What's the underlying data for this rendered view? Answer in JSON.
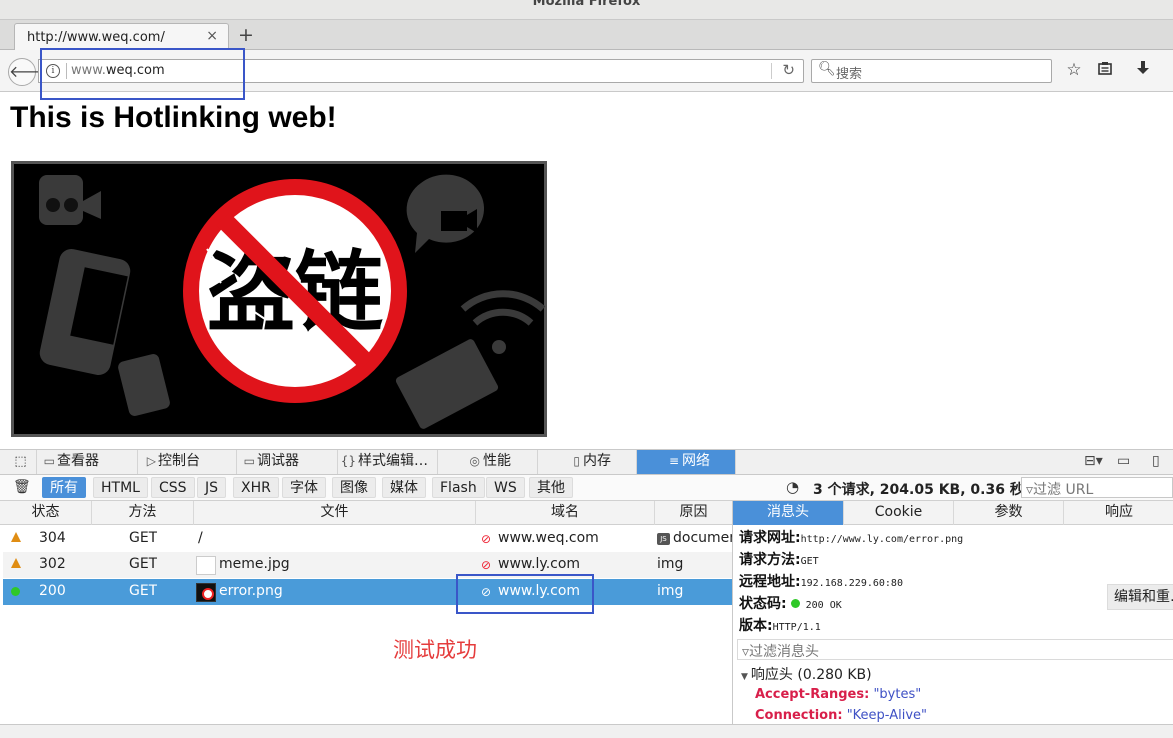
{
  "window": {
    "title": "Mozilla Firefox"
  },
  "tabbar": {
    "tab_title": "http://www.weq.com/",
    "close_glyph": "×",
    "new_tab_glyph": "+"
  },
  "navbar": {
    "back_glyph": "🡐",
    "url_host_prefix": "www.",
    "url_host_main": "weq.com",
    "search_placeholder": "搜索",
    "icons": [
      "info-icon",
      "reload-icon",
      "search-icon",
      "bookmark-star-icon",
      "reading-list-icon",
      "download-icon"
    ]
  },
  "page": {
    "heading": "This is Hotlinking web!",
    "image_text": "盗链"
  },
  "devtools": {
    "tabs": [
      {
        "label": "查看器",
        "icon": "▭"
      },
      {
        "label": "控制台",
        "icon": "▷"
      },
      {
        "label": "调试器",
        "icon": "▭"
      },
      {
        "label": "样式编辑…",
        "icon": "{}"
      },
      {
        "label": "性能",
        "icon": "◎"
      },
      {
        "label": "内存",
        "icon": "▯"
      },
      {
        "label": "网络",
        "icon": "≡",
        "active": true
      }
    ],
    "filters": [
      "所有",
      "HTML",
      "CSS",
      "JS",
      "XHR",
      "字体",
      "图像",
      "媒体",
      "Flash",
      "WS",
      "其他"
    ],
    "active_filter": "所有",
    "summary": "3 个请求, 204.05 KB, 0.36 秒",
    "url_filter_placeholder": "过滤 URL",
    "columns": [
      "状态",
      "方法",
      "文件",
      "域名",
      "原因"
    ],
    "requests": [
      {
        "status": "304",
        "indicator": "warning",
        "method": "GET",
        "file": "/",
        "domain": "www.weq.com",
        "cause": "documen",
        "cause_icon": "JS"
      },
      {
        "status": "302",
        "indicator": "warning",
        "method": "GET",
        "file": "meme.jpg",
        "domain": "www.ly.com",
        "cause": "img"
      },
      {
        "status": "200",
        "indicator": "ok",
        "method": "GET",
        "file": "error.png",
        "domain": "www.ly.com",
        "cause": "img",
        "selected": true
      }
    ],
    "annotation": "测试成功"
  },
  "details": {
    "tabs": [
      "消息头",
      "Cookie",
      "参数",
      "响应"
    ],
    "active_tab": "消息头",
    "request_url_label": "请求网址:",
    "request_url": "http://www.ly.com/error.png",
    "method_label": "请求方法:",
    "method": "GET",
    "remote_label": "远程地址:",
    "remote": "192.168.229.60:80",
    "status_label": "状态码:",
    "status": "200 OK",
    "version_label": "版本:",
    "version": "HTTP/1.1",
    "edit_resend": "编辑和重…",
    "header_filter_placeholder": "过滤消息头",
    "response_headers_label": "响应头 (0.280 KB)",
    "response_headers": [
      {
        "name": "Accept-Ranges:",
        "value": "\"bytes\""
      },
      {
        "name": "Connection:",
        "value": "\"Keep-Alive\""
      }
    ]
  },
  "colors": {
    "accent": "#4a90d9",
    "annotation_box": "#3a56c8",
    "annotation_text": "#e53c3c",
    "status_ok": "#2fc828",
    "status_warn": "#e08d13"
  }
}
